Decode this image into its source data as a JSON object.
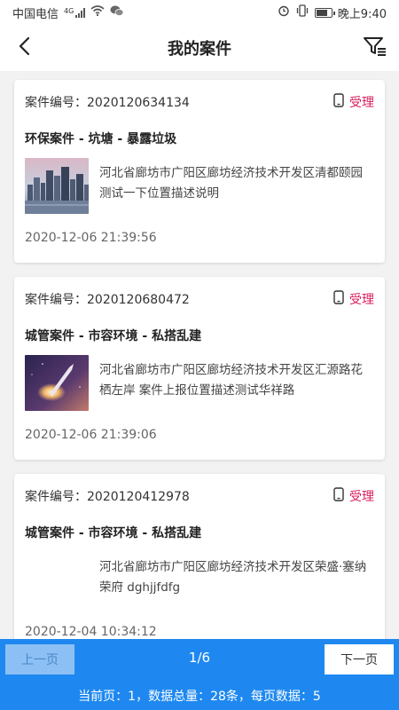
{
  "statusbar": {
    "carrier": "中国电信",
    "network": "4G",
    "time": "晚上9:40",
    "icons": [
      "signal-icon",
      "wifi-icon",
      "wechat-icon",
      "alarm-icon",
      "vibrate-icon",
      "battery-icon"
    ]
  },
  "navbar": {
    "title": "我的案件",
    "back_icon": "chevron-left-icon",
    "filter_icon": "filter-icon"
  },
  "cases": [
    {
      "case_no": "案件编号：2020120634134",
      "status": "受理",
      "category": "环保案件 - 坑塘 - 暴露垃圾",
      "description": "河北省廊坊市广阳区廊坊经济技术开发区清都颐园 测试一下位置描述说明",
      "time": "2020-12-06 21:39:56",
      "thumb": "city-skyline"
    },
    {
      "case_no": "案件编号：2020120680472",
      "status": "受理",
      "category": "城管案件 - 市容环境 - 私搭乱建",
      "description": "河北省廊坊市广阳区廊坊经济技术开发区汇源路花栖左岸 案件上报位置描述测试华祥路",
      "time": "2020-12-06 21:39:06",
      "thumb": "rocket-launch"
    },
    {
      "case_no": "案件编号：2020120412978",
      "status": "受理",
      "category": "城管案件 - 市容环境 - 私搭乱建",
      "description": "河北省廊坊市广阳区廊坊经济技术开发区荣盛·塞纳荣府 dghjjfdfg",
      "time": "2020-12-04 10:34:12",
      "thumb": ""
    }
  ],
  "pager": {
    "prev_label": "上一页",
    "next_label": "下一页",
    "page": "1/6",
    "summary": "当前页：1，数据总量：28条，每页数据：5"
  },
  "colors": {
    "accent_blue": "#1e88f0",
    "status_red": "#d81e5b"
  }
}
